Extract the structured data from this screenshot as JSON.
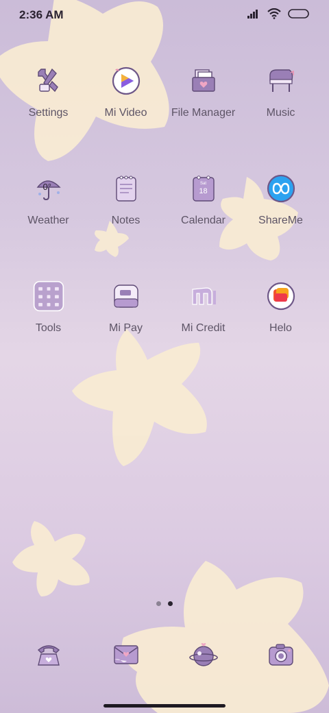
{
  "status_bar": {
    "time": "2:36 AM",
    "icons": [
      "signal-icon",
      "wifi-icon",
      "battery-icon"
    ]
  },
  "home": {
    "apps": [
      {
        "label": "Settings",
        "icon": "settings-icon"
      },
      {
        "label": "Mi Video",
        "icon": "mi-video-icon"
      },
      {
        "label": "File Manager",
        "icon": "file-manager-icon"
      },
      {
        "label": "Music",
        "icon": "music-icon"
      },
      {
        "label": "Weather",
        "icon": "weather-icon",
        "value": "0°"
      },
      {
        "label": "Notes",
        "icon": "notes-icon"
      },
      {
        "label": "Calendar",
        "icon": "calendar-icon",
        "value": "18",
        "day": "Sat"
      },
      {
        "label": "ShareMe",
        "icon": "shareme-icon"
      },
      {
        "label": "Tools",
        "icon": "tools-folder-icon"
      },
      {
        "label": "Mi Pay",
        "icon": "mi-pay-icon"
      },
      {
        "label": "Mi Credit",
        "icon": "mi-credit-icon"
      },
      {
        "label": "Helo",
        "icon": "helo-icon"
      }
    ]
  },
  "page_indicator": {
    "pages": 2,
    "current": 2
  },
  "dock": {
    "apps": [
      {
        "icon": "phone-icon"
      },
      {
        "icon": "messages-icon"
      },
      {
        "icon": "browser-icon"
      },
      {
        "icon": "camera-icon"
      }
    ]
  },
  "colors": {
    "icon_purple": "#9a7fb6",
    "icon_dark": "#6e5788",
    "star": "#fcf1d2",
    "label": "#5d5466"
  }
}
